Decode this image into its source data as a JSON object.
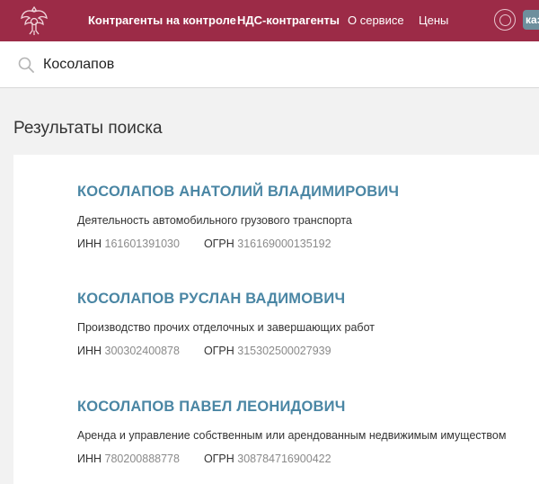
{
  "header": {
    "nav": [
      {
        "label": "Контрагенты на контроле"
      },
      {
        "label": "НДС-контрагенты"
      },
      {
        "label": "О сервисе"
      },
      {
        "label": "Цены"
      }
    ],
    "lang_badge": "каз",
    "brand_color": "#9c2b47"
  },
  "search": {
    "value": "Косолапов"
  },
  "results": {
    "title": "Результаты поиска",
    "items": [
      {
        "name": "КОСОЛАПОВ АНАТОЛИЙ ВЛАДИМИРОВИЧ",
        "activity": "Деятельность автомобильного грузового транспорта",
        "inn_label": "ИНН",
        "inn": "161601391030",
        "ogrn_label": "ОГРН",
        "ogrn": "316169000135192"
      },
      {
        "name": "КОСОЛАПОВ РУСЛАН ВАДИМОВИЧ",
        "activity": "Производство прочих отделочных и завершающих работ",
        "inn_label": "ИНН",
        "inn": "300302400878",
        "ogrn_label": "ОГРН",
        "ogrn": "315302500027939"
      },
      {
        "name": "КОСОЛАПОВ ПАВЕЛ ЛЕОНИДОВИЧ",
        "activity": "Аренда и управление собственным или арендованным недвижимым имуществом",
        "inn_label": "ИНН",
        "inn": "780200888778",
        "ogrn_label": "ОГРН",
        "ogrn": "308784716900422"
      }
    ]
  },
  "colors": {
    "link": "#4a86a4",
    "muted": "#8a8a8a",
    "background": "#f2f2f2"
  }
}
